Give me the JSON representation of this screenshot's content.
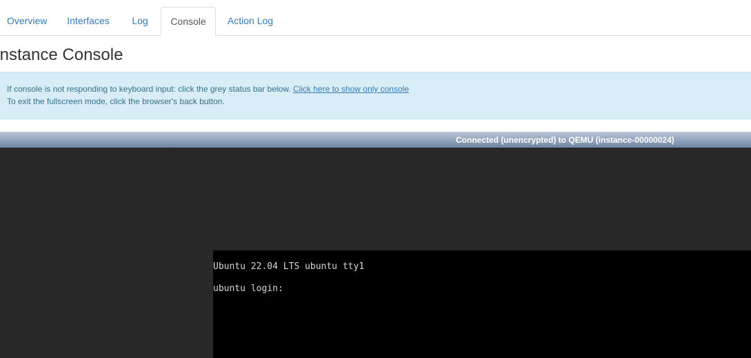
{
  "tabs": [
    {
      "label": "Overview",
      "active": false
    },
    {
      "label": "Interfaces",
      "active": false
    },
    {
      "label": "Log",
      "active": false
    },
    {
      "label": "Console",
      "active": true
    },
    {
      "label": "Action Log",
      "active": false
    }
  ],
  "page": {
    "title": "Instance Console"
  },
  "info": {
    "line1_text": "If console is not responding to keyboard input: click the grey status bar below. ",
    "line1_link": "Click here to show only console",
    "line2_text": "To exit the fullscreen mode, click the browser's back button."
  },
  "console": {
    "status": "Connected (unencrypted) to QEMU (instance-00000024)",
    "lines": [
      "Ubuntu 22.04 LTS ubuntu tty1",
      "ubuntu login:"
    ]
  },
  "colors": {
    "link": "#337ab7",
    "info_bg": "#d9edf7",
    "console_bg": "#282828",
    "screen_bg": "#000000"
  }
}
